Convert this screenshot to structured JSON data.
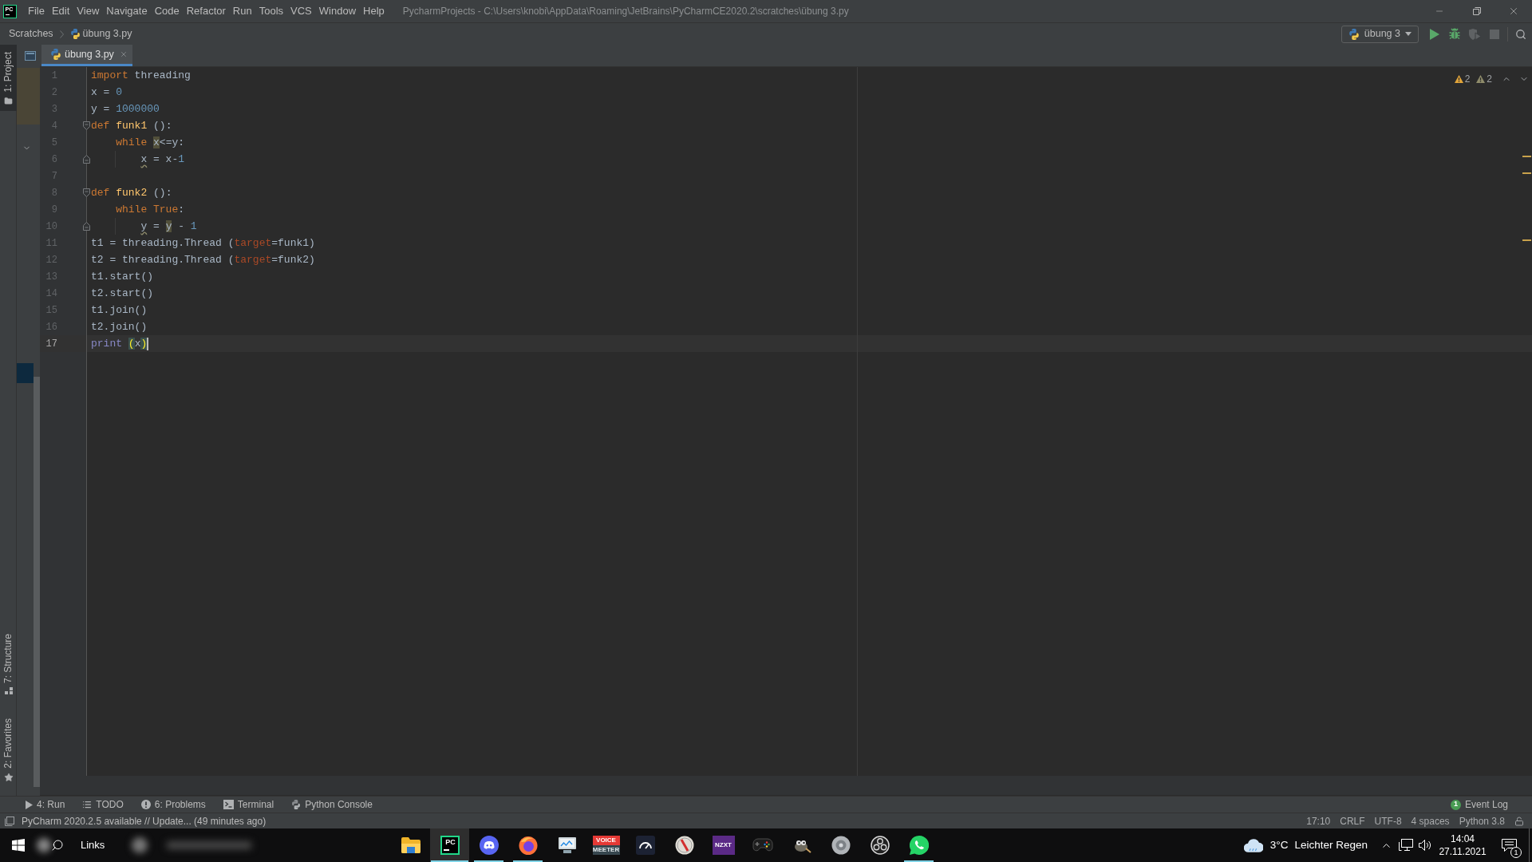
{
  "title_bar": {
    "logo": "PC",
    "menu": [
      "File",
      "Edit",
      "View",
      "Navigate",
      "Code",
      "Refactor",
      "Run",
      "Tools",
      "VCS",
      "Window",
      "Help"
    ],
    "title": "PycharmProjects - C:\\Users\\knobi\\AppData\\Roaming\\JetBrains\\PyCharmCE2020.2\\scratches\\übung 3.py"
  },
  "navigation_bar": {
    "breadcrumbs": [
      "Scratches",
      "übung 3.py"
    ],
    "run_configuration": "übung 3",
    "toolbar": [
      {
        "disabled": false
      },
      {
        "disabled": false
      },
      {
        "disabled": true
      },
      {
        "disabled": true
      }
    ]
  },
  "tool_stripe": {
    "top": [
      {
        "label": "1: Project",
        "selected": true
      }
    ],
    "bottom": [
      {
        "label": "7: Structure",
        "selected": false
      },
      {
        "label": "2: Favorites",
        "selected": false
      }
    ]
  },
  "editor_tabs": [
    {
      "label": "übung 3.py",
      "selected": true
    }
  ],
  "editor": {
    "inspections": [
      {
        "kind": "warning",
        "count": "2"
      },
      {
        "kind": "weak_warning",
        "count": "2"
      }
    ],
    "lines": [
      {
        "number": "1",
        "current": false,
        "tokens": [
          {
            "text": "import",
            "kind": "keyword"
          },
          {
            "text": " threading",
            "kind": "plain"
          }
        ]
      },
      {
        "number": "2",
        "current": false,
        "tokens": [
          {
            "text": "x = ",
            "kind": "plain"
          },
          {
            "text": "0",
            "kind": "number"
          }
        ]
      },
      {
        "number": "3",
        "current": false,
        "tokens": [
          {
            "text": "y = ",
            "kind": "plain"
          },
          {
            "text": "1000000",
            "kind": "number"
          }
        ]
      },
      {
        "number": "4",
        "kind": "fold_start",
        "current": false,
        "tokens": [
          {
            "text": "def ",
            "kind": "keyword"
          },
          {
            "text": "funk1",
            "kind": "function"
          },
          {
            "text": " ():",
            "kind": "plain"
          }
        ],
        "children": [
          {
            "number": "5",
            "current": false,
            "tokens": [
              {
                "text": "while ",
                "kind": "keyword"
              },
              {
                "text": "x",
                "kind": "occurrence"
              },
              {
                "text": "<=y:",
                "kind": "plain"
              }
            ],
            "children": [
              {
                "number": "6",
                "kind": "fold_end",
                "current": false,
                "tokens": [
                  {
                    "text": "x",
                    "kind": "weak_warning"
                  },
                  {
                    "text": " = x-",
                    "kind": "plain"
                  },
                  {
                    "text": "1",
                    "kind": "number"
                  }
                ]
              }
            ]
          }
        ]
      },
      {
        "number": "7",
        "current": false
      },
      {
        "number": "8",
        "kind": "fold_start",
        "current": false,
        "tokens": [
          {
            "text": "def ",
            "kind": "keyword"
          },
          {
            "text": "funk2",
            "kind": "function"
          },
          {
            "text": " ():",
            "kind": "plain"
          }
        ],
        "children": [
          {
            "number": "9",
            "current": false,
            "tokens": [
              {
                "text": "while True",
                "kind": "keyword"
              },
              {
                "text": ":",
                "kind": "plain"
              }
            ],
            "children": [
              {
                "number": "10",
                "kind": "fold_end",
                "current": false,
                "tokens": [
                  {
                    "text": "y",
                    "kind": "weak_warning"
                  },
                  {
                    "text": " = ",
                    "kind": "plain"
                  },
                  {
                    "text": "y",
                    "kind": "occurrence"
                  },
                  {
                    "text": " - ",
                    "kind": "plain"
                  },
                  {
                    "text": "1",
                    "kind": "number"
                  }
                ]
              }
            ]
          }
        ]
      },
      {
        "number": "11",
        "current": false,
        "tokens": [
          {
            "text": "t1 = threading.Thread (",
            "kind": "plain"
          },
          {
            "text": "target",
            "kind": "param"
          },
          {
            "text": "=funk1)",
            "kind": "plain"
          }
        ]
      },
      {
        "number": "12",
        "current": false,
        "tokens": [
          {
            "text": "t2 = threading.Thread (",
            "kind": "plain"
          },
          {
            "text": "target",
            "kind": "param"
          },
          {
            "text": "=funk2)",
            "kind": "plain"
          }
        ]
      },
      {
        "number": "13",
        "current": false,
        "tokens": [
          {
            "text": "t1.start()",
            "kind": "plain"
          }
        ]
      },
      {
        "number": "14",
        "current": false,
        "tokens": [
          {
            "text": "t2.start()",
            "kind": "plain"
          }
        ]
      },
      {
        "number": "15",
        "current": false,
        "tokens": [
          {
            "text": "t1.join()",
            "kind": "plain"
          }
        ]
      },
      {
        "number": "16",
        "current": false,
        "tokens": [
          {
            "text": "t2.join()",
            "kind": "plain"
          }
        ]
      },
      {
        "number": "17",
        "current": true,
        "tokens": [
          {
            "text": "print ",
            "kind": "builtin"
          },
          {
            "text": "(",
            "kind": "brace_match"
          },
          {
            "text": "x",
            "kind": "plain"
          },
          {
            "text": ")",
            "kind": "brace_match"
          }
        ]
      }
    ]
  },
  "tool_windows": [
    {
      "label": "4: Run"
    },
    {
      "label": "TODO"
    },
    {
      "label": "6: Problems"
    },
    {
      "label": "Terminal"
    },
    {
      "label": "Python Console"
    }
  ],
  "event_log": {
    "label": "Event Log",
    "count": "1"
  },
  "status_bar": {
    "message": "PyCharm 2020.2.5 available // Update... (49 minutes ago)",
    "items": [
      "17:10",
      "CRLF",
      "UTF-8",
      "4 spaces",
      "Python 3.8"
    ]
  },
  "taskbar": {
    "search_label": "Links",
    "apps": [
      {
        "running": false,
        "selected": false
      },
      {
        "running": true,
        "selected": true,
        "label": "PC"
      },
      {
        "running": true,
        "selected": false
      },
      {
        "running": true,
        "selected": false
      },
      {
        "running": false,
        "selected": false
      },
      {
        "running": false,
        "selected": false,
        "label": "VOICE",
        "sublabel": "MEETER"
      },
      {
        "running": false,
        "selected": false
      },
      {
        "running": false,
        "selected": false
      },
      {
        "running": false,
        "selected": false,
        "label": "NZXT"
      },
      {
        "running": false,
        "selected": false
      },
      {
        "running": false,
        "selected": false
      },
      {
        "running": false,
        "selected": false
      },
      {
        "running": false,
        "selected": false
      },
      {
        "running": true,
        "selected": false
      }
    ],
    "weather": {
      "temperature": "3°C",
      "condition": "Leichter Regen"
    },
    "clock": {
      "time": "14:04",
      "date": "27.11.2021"
    },
    "notification_count": "1"
  }
}
